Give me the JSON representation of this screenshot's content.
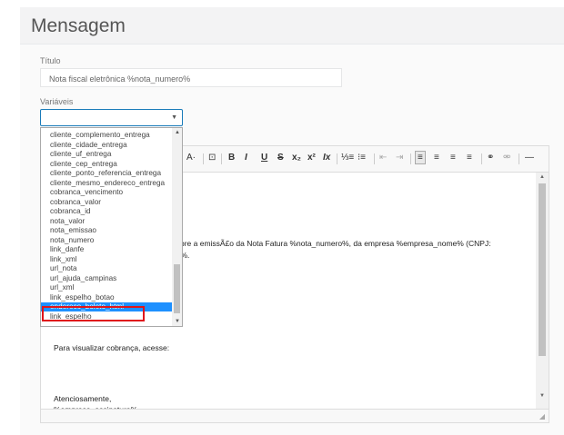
{
  "page": {
    "title": "Mensagem",
    "titulo_label": "Título",
    "titulo_value": "Nota fiscal eletrônica %nota_numero%",
    "variaveis_label": "Variáveis",
    "variaveis_value": ""
  },
  "dropdown": {
    "options": [
      "cliente_complemento_entrega",
      "cliente_cidade_entrega",
      "cliente_uf_entrega",
      "cliente_cep_entrega",
      "cliente_ponto_referencia_entrega",
      "cliente_mesmo_endereco_entrega",
      "cobranca_vencimento",
      "cobranca_valor",
      "cobranca_id",
      "nota_valor",
      "nota_emissao",
      "nota_numero",
      "link_danfe",
      "link_xml",
      "url_nota",
      "url_ajuda_campinas",
      "url_xml",
      "link_espelho_botao",
      "endereco_boleto_html",
      "link_espelho"
    ],
    "selected": "endereco_boleto_html"
  },
  "toolbar": {
    "block_format": "A·",
    "insert": "⊡",
    "bold": "B",
    "italic": "I",
    "underline": "U",
    "strike": "S",
    "subscript": "x₂",
    "superscript": "x²",
    "clear_format": "Ix",
    "ordered_list": "⅓≡",
    "bullet_list": "⁝≡",
    "outdent": "⇤",
    "indent": "⇥",
    "align_left": "≡",
    "align_center": "≡",
    "align_right": "≡",
    "align_justify": "≡",
    "link": "⚭",
    "unlink": "⚮",
    "hr": "―"
  },
  "editor": {
    "line1": "sobre a emissÃ£o da Nota Fatura %nota_numero%, da empresa %empresa_nome% (CNPJ:",
    "line2": "ne%.",
    "line3": "Para visualizar cobrança, acesse:",
    "line4": "Atenciosamente,",
    "line5": "%empresa_assinatura%"
  },
  "colors": {
    "accent": "#1a7bb9",
    "selected_option": "#1e90ff",
    "highlight_box": "#e0151b"
  }
}
